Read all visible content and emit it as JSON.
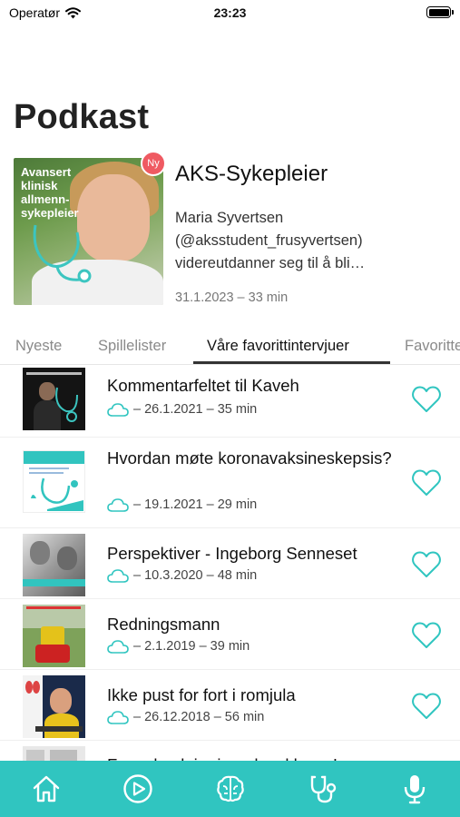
{
  "status_bar": {
    "carrier": "Operatør",
    "time": "23:23"
  },
  "page_title": "Podkast",
  "featured": {
    "art_text": "Avansert klinisk allmenn-sykepleier",
    "badge": "Ny",
    "title": "AKS-Sykepleier",
    "description": "Maria Syvertsen (@aksstudent_frusyvertsen) videreutdanner seg til å bli…",
    "meta": "31.1.2023 –  33 min"
  },
  "tabs": [
    "Nyeste",
    "Spillelister",
    "Våre favorittintervjuer",
    "Favoritter"
  ],
  "active_tab": "Våre favorittintervjuer",
  "episodes": [
    {
      "title": "Kommentarfeltet til Kaveh",
      "meta": "– 26.1.2021 – 35 min",
      "thumb": "kaveh"
    },
    {
      "title": "Hvordan møte koronavaksineskepsis?",
      "meta": "– 19.1.2021 – 29 min",
      "thumb": "vaccine"
    },
    {
      "title": "Perspektiver - Ingeborg Senneset",
      "meta": "– 10.3.2020 – 48 min",
      "thumb": "ingeborg"
    },
    {
      "title": "Redningsmann",
      "meta": "– 2.1.2019 – 39 min",
      "thumb": "rescue"
    },
    {
      "title": "Ikke pust for fort i romjula",
      "meta": "– 26.12.2018 – 56 min",
      "thumb": "lungs"
    },
    {
      "title": "Fra sykepleier i verdensklasse!",
      "meta": "",
      "thumb": "partial"
    }
  ],
  "icons": {
    "status": [
      "wifi-icon",
      "battery-icon"
    ],
    "episode": [
      "cloud-icon",
      "heart-icon"
    ],
    "tabbar": [
      "home-icon",
      "play-icon",
      "brain-icon",
      "stethoscope-icon",
      "microphone-icon"
    ]
  },
  "colors": {
    "accent": "#30c5c0",
    "badge": "#ef5a62",
    "text": "#111111",
    "muted": "#777777"
  }
}
